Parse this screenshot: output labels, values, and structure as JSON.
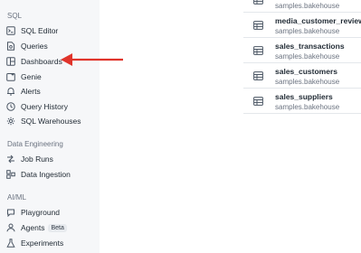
{
  "sidebar": {
    "sections": [
      {
        "label": "SQL",
        "items": [
          {
            "label": "SQL Editor",
            "icon": "sql-editor-icon"
          },
          {
            "label": "Queries",
            "icon": "queries-icon"
          },
          {
            "label": "Dashboards",
            "icon": "dashboards-icon"
          },
          {
            "label": "Genie",
            "icon": "genie-icon"
          },
          {
            "label": "Alerts",
            "icon": "alerts-icon"
          },
          {
            "label": "Query History",
            "icon": "query-history-icon"
          },
          {
            "label": "SQL Warehouses",
            "icon": "sql-warehouses-icon"
          }
        ]
      },
      {
        "label": "Data Engineering",
        "items": [
          {
            "label": "Job Runs",
            "icon": "job-runs-icon"
          },
          {
            "label": "Data Ingestion",
            "icon": "data-ingestion-icon"
          }
        ]
      },
      {
        "label": "AI/ML",
        "items": [
          {
            "label": "Playground",
            "icon": "playground-icon"
          },
          {
            "label": "Agents",
            "icon": "agents-icon",
            "badge": "Beta"
          },
          {
            "label": "Experiments",
            "icon": "experiments-icon"
          }
        ]
      }
    ]
  },
  "annotation": {
    "arrow_color": "#e0342b",
    "points_to": "Dashboards"
  },
  "tables": [
    {
      "name": "",
      "schema": "samples.bakehouse"
    },
    {
      "name": "media_customer_reviews",
      "schema": "samples.bakehouse"
    },
    {
      "name": "sales_transactions",
      "schema": "samples.bakehouse"
    },
    {
      "name": "sales_customers",
      "schema": "samples.bakehouse"
    },
    {
      "name": "sales_suppliers",
      "schema": "samples.bakehouse"
    }
  ]
}
